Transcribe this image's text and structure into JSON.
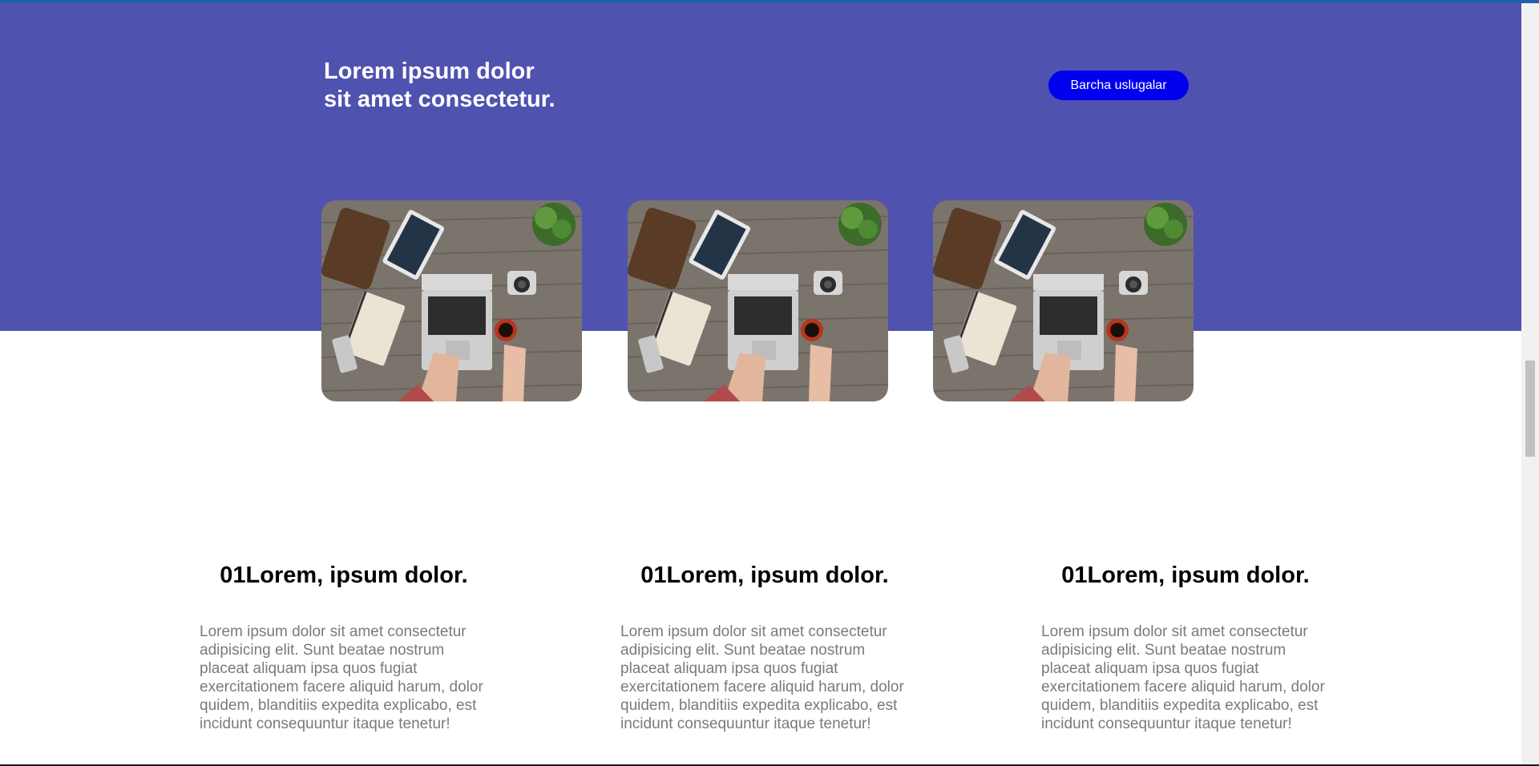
{
  "hero": {
    "title_line1": "Lorem ipsum dolor",
    "title_line2": "sit amet consectetur.",
    "button_label": "Barcha uslugalar"
  },
  "colors": {
    "hero_background": "#5052b0",
    "button_background": "#0000ee",
    "body_text": "#7a7a7a"
  },
  "cards": [
    {
      "image": "workspace-laptop-photo"
    },
    {
      "image": "workspace-laptop-photo"
    },
    {
      "image": "workspace-laptop-photo"
    }
  ],
  "features": [
    {
      "title": "01Lorem, ipsum dolor.",
      "text": "Lorem ipsum dolor sit amet consectetur adipisicing elit. Sunt beatae nostrum placeat aliquam ipsa quos fugiat exercitationem facere aliquid harum, dolor quidem, blanditiis expedita explicabo, est incidunt consequuntur itaque tenetur!"
    },
    {
      "title": "01Lorem, ipsum dolor.",
      "text": "Lorem ipsum dolor sit amet consectetur adipisicing elit. Sunt beatae nostrum placeat aliquam ipsa quos fugiat exercitationem facere aliquid harum, dolor quidem, blanditiis expedita explicabo, est incidunt consequuntur itaque tenetur!"
    },
    {
      "title": "01Lorem, ipsum dolor.",
      "text": "Lorem ipsum dolor sit amet consectetur adipisicing elit. Sunt beatae nostrum placeat aliquam ipsa quos fugiat exercitationem facere aliquid harum, dolor quidem, blanditiis expedita explicabo, est incidunt consequuntur itaque tenetur!"
    }
  ]
}
